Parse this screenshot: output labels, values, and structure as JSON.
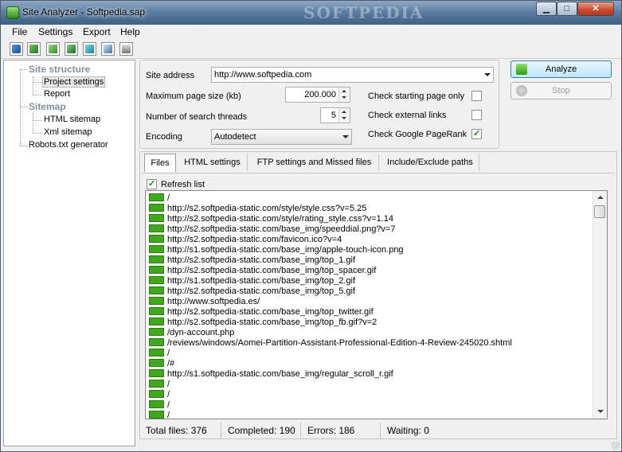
{
  "window": {
    "title": "Site Analyzer - Softpedia.sap",
    "watermark": "SOFTPEDIA"
  },
  "menu": [
    "File",
    "Settings",
    "Export",
    "Help"
  ],
  "toolbar": {
    "icons": [
      "open-icon",
      "excel-export-icon",
      "excel-icon",
      "csv-export-icon",
      "html-export-icon",
      "report-icon",
      "print-icon"
    ]
  },
  "tree": {
    "site_structure": "Site structure",
    "project_settings": "Project settings",
    "report": "Report",
    "sitemap": "Sitemap",
    "html_sitemap": "HTML sitemap",
    "xml_sitemap": "Xml sitemap",
    "robots": "Robots.txt generator"
  },
  "settings": {
    "site_address_label": "Site address",
    "site_address_value": "http://www.softpedia.com",
    "max_page_size_label": "Maximum page size (kb)",
    "max_page_size_value": "200.000",
    "threads_label": "Number of search threads",
    "threads_value": "5",
    "encoding_label": "Encoding",
    "encoding_value": "Autodetect",
    "check_starting_page": {
      "label": "Check starting page only",
      "checked": false
    },
    "check_external": {
      "label": "Check external links",
      "checked": false
    },
    "check_pagerank": {
      "label": "Check Google PageRank",
      "checked": true
    }
  },
  "buttons": {
    "analyze": "Analyze",
    "stop": "Stop"
  },
  "tabs": [
    "Files",
    "HTML settings",
    "FTP settings and Missed files",
    "Include/Exclude paths"
  ],
  "files": {
    "refresh_label": "Refresh list",
    "refresh_checked": true,
    "rows": [
      "/",
      "http://s2.softpedia-static.com/style/style.css?v=5.25",
      "http://s2.softpedia-static.com/style/rating_style.css?v=1.14",
      "http://s2.softpedia-static.com/base_img/speeddial.png?v=7",
      "http://s2.softpedia-static.com/favicon.ico?v=4",
      "http://s1.softpedia-static.com/base_img/apple-touch-icon.png",
      "http://s2.softpedia-static.com/base_img/top_1.gif",
      "http://s2.softpedia-static.com/base_img/top_spacer.gif",
      "http://s1.softpedia-static.com/base_img/top_2.gif",
      "http://s2.softpedia-static.com/base_img/top_5.gif",
      "http://www.softpedia.es/",
      "http://s2.softpedia-static.com/base_img/top_twitter.gif",
      "http://s2.softpedia-static.com/base_img/top_fb.gif?v=2",
      "/dyn-account.php",
      "/reviews/windows/Aomei-Partition-Assistant-Professional-Edition-4-Review-245020.shtml",
      "/",
      "/#",
      "http://s1.softpedia-static.com/base_img/regular_scroll_r.gif",
      "/",
      "/",
      "/",
      "/"
    ]
  },
  "status": {
    "total": "Total files: 376",
    "completed": "Completed: 190",
    "errors": "Errors: 186",
    "waiting": "Waiting: 0"
  },
  "colors": {
    "progress_green": "#3fa81d",
    "title_blue": "#5e7fa3"
  }
}
